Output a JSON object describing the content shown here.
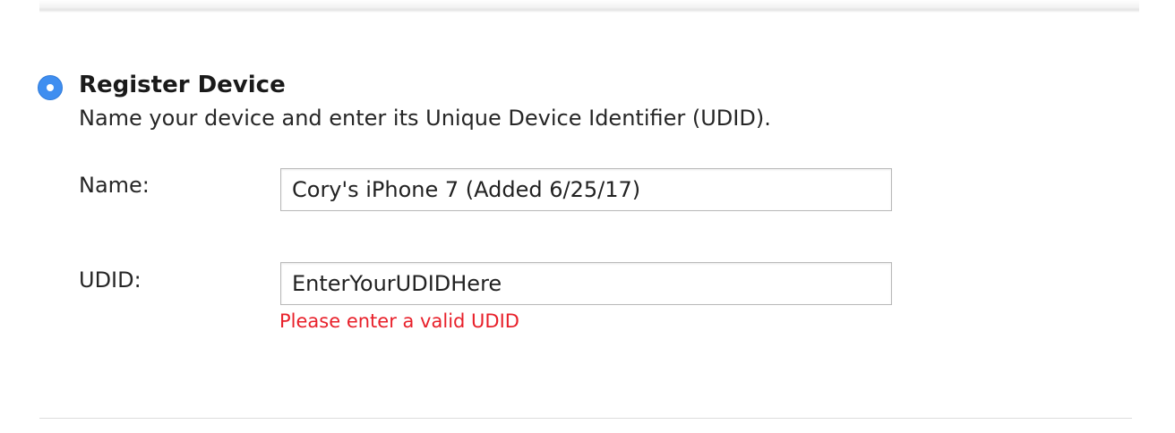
{
  "register": {
    "title": "Register Device",
    "description": "Name your device and enter its Unique Device Identifier (UDID).",
    "selected": true
  },
  "fields": {
    "name": {
      "label": "Name:",
      "value": "Cory's iPhone 7 (Added 6/25/17)"
    },
    "udid": {
      "label": "UDID:",
      "value": "EnterYourUDIDHere",
      "error": "Please enter a valid UDID"
    }
  },
  "colors": {
    "accent": "#3f8ef0",
    "error": "#e8202a",
    "input_border": "#b8b8b8"
  }
}
